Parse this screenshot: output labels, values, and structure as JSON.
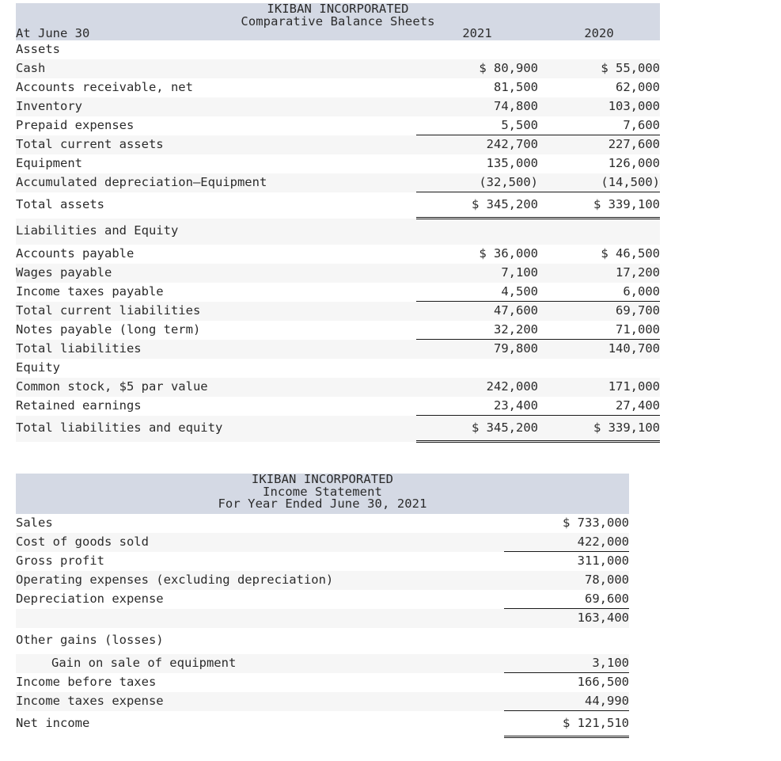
{
  "balance_sheet": {
    "company": "IKIBAN INCORPORATED",
    "statement_title": "Comparative Balance Sheets",
    "period_label": "At June 30",
    "columns": [
      "2021",
      "2020"
    ],
    "rows": [
      {
        "label": "Assets",
        "y2021": "",
        "y2020": ""
      },
      {
        "label": "Cash",
        "y2021": "$ 80,900",
        "y2020": "$ 55,000"
      },
      {
        "label": "Accounts receivable, net",
        "y2021": "81,500",
        "y2020": "62,000"
      },
      {
        "label": "Inventory",
        "y2021": "74,800",
        "y2020": "103,000"
      },
      {
        "label": "Prepaid expenses",
        "y2021": "5,500",
        "y2020": "7,600"
      },
      {
        "label": "Total current assets",
        "y2021": "242,700",
        "y2020": "227,600"
      },
      {
        "label": "Equipment",
        "y2021": "135,000",
        "y2020": "126,000"
      },
      {
        "label": "Accumulated depreciation—Equipment",
        "y2021": "(32,500)",
        "y2020": "(14,500)"
      },
      {
        "label": "Total assets",
        "y2021": "$ 345,200",
        "y2020": "$ 339,100"
      },
      {
        "label": "Liabilities and Equity",
        "y2021": "",
        "y2020": ""
      },
      {
        "label": "Accounts payable",
        "y2021": "$ 36,000",
        "y2020": "$ 46,500"
      },
      {
        "label": "Wages payable",
        "y2021": "7,100",
        "y2020": "17,200"
      },
      {
        "label": "Income taxes payable",
        "y2021": "4,500",
        "y2020": "6,000"
      },
      {
        "label": "Total current liabilities",
        "y2021": "47,600",
        "y2020": "69,700"
      },
      {
        "label": "Notes payable (long term)",
        "y2021": "32,200",
        "y2020": "71,000"
      },
      {
        "label": "Total liabilities",
        "y2021": "79,800",
        "y2020": "140,700"
      },
      {
        "label": "Equity",
        "y2021": "",
        "y2020": ""
      },
      {
        "label": "Common stock, $5 par value",
        "y2021": "242,000",
        "y2020": "171,000"
      },
      {
        "label": "Retained earnings",
        "y2021": "23,400",
        "y2020": "27,400"
      },
      {
        "label": "Total liabilities and equity",
        "y2021": "$ 345,200",
        "y2020": "$ 339,100"
      }
    ]
  },
  "income_statement": {
    "company": "IKIBAN INCORPORATED",
    "statement_title": "Income Statement",
    "period_title": "For Year Ended June 30, 2021",
    "rows": [
      {
        "label": "Sales",
        "amount": "$ 733,000"
      },
      {
        "label": "Cost of goods sold",
        "amount": "422,000"
      },
      {
        "label": "Gross profit",
        "amount": "311,000"
      },
      {
        "label": "Operating expenses (excluding depreciation)",
        "amount": "78,000"
      },
      {
        "label": "Depreciation expense",
        "amount": "69,600"
      },
      {
        "label": "",
        "amount": "163,400"
      },
      {
        "label": "Other gains (losses)",
        "amount": ""
      },
      {
        "label": "Gain on sale of equipment",
        "amount": "3,100"
      },
      {
        "label": "Income before taxes",
        "amount": "166,500"
      },
      {
        "label": "Income taxes expense",
        "amount": "44,990"
      },
      {
        "label": "Net income",
        "amount": "$ 121,510"
      }
    ]
  },
  "colors": {
    "header_band": "#d4d9e4",
    "stripe": "#f6f6f6",
    "text": "#2b2b2b",
    "rule": "#1a1a1a"
  }
}
